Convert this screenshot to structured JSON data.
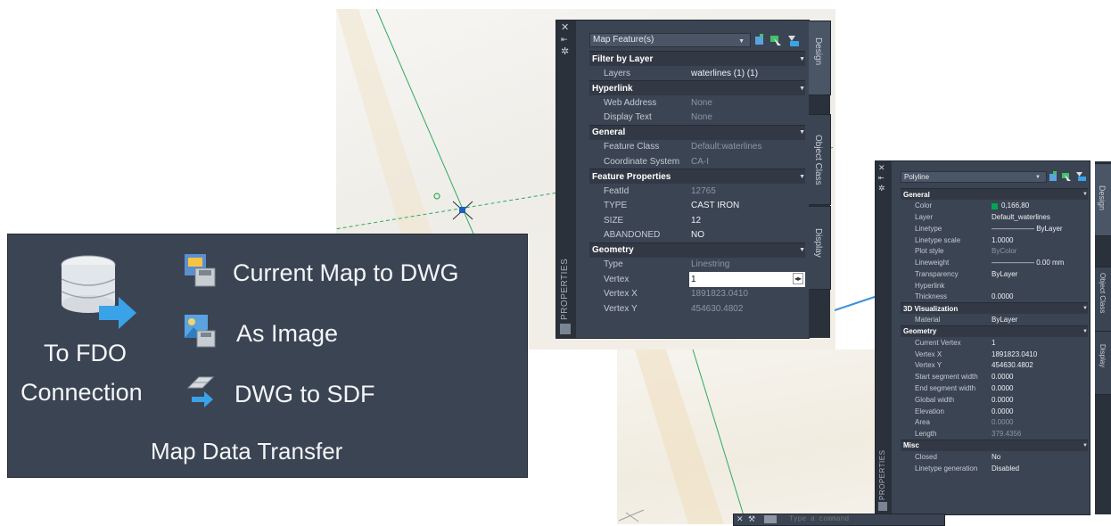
{
  "colors": {
    "panel_bg": "#3b4453",
    "panel_dark": "#2a313b",
    "text": "#eef1f4",
    "dim_text": "#8d96a1",
    "map_line_green": "#2eaa5f",
    "map_line_blue": "#3d8fd6",
    "layer_color_swatch": "#00a651"
  },
  "ribbon": {
    "to_fdo_line1": "To FDO",
    "to_fdo_line2": "Connection",
    "current_map_to_dwg": "Current Map to DWG",
    "as_image": "As Image",
    "dwg_to_sdf": "DWG to SDF",
    "panel_title": "Map Data Transfer"
  },
  "palette1": {
    "selector": "Map Feature(s)",
    "side_label": "PROPERTIES",
    "tabs": [
      "Design",
      "Object Class",
      "Display"
    ],
    "sections": [
      {
        "title": "Filter by Layer",
        "rows": [
          {
            "key": "Layers",
            "value": "waterlines (1) (1)",
            "dim": false
          }
        ]
      },
      {
        "title": "Hyperlink",
        "rows": [
          {
            "key": "Web Address",
            "value": "None",
            "dim": true
          },
          {
            "key": "Display Text",
            "value": "None",
            "dim": true
          }
        ]
      },
      {
        "title": "General",
        "rows": [
          {
            "key": "Feature Class",
            "value": "Default:waterlines",
            "dim": true
          },
          {
            "key": "Coordinate System",
            "value": "CA-I",
            "dim": true
          }
        ]
      },
      {
        "title": "Feature Properties",
        "rows": [
          {
            "key": "FeatId",
            "value": "12765",
            "dim": true
          },
          {
            "key": "TYPE",
            "value": "CAST IRON",
            "dim": false
          },
          {
            "key": "SIZE",
            "value": "12",
            "dim": false
          },
          {
            "key": "ABANDONED",
            "value": "NO",
            "dim": false
          }
        ]
      },
      {
        "title": "Geometry",
        "rows": [
          {
            "key": "Type",
            "value": "Linestring",
            "dim": true
          },
          {
            "key": "Vertex",
            "value": "1",
            "dim": false
          },
          {
            "key": "Vertex X",
            "value": "1891823.0410",
            "dim": true
          },
          {
            "key": "Vertex Y",
            "value": "454630.4802",
            "dim": true
          }
        ]
      }
    ]
  },
  "palette2": {
    "selector": "Polyline",
    "side_label": "PROPERTIES",
    "tabs": [
      "Design",
      "Object Class",
      "Display"
    ],
    "sections": [
      {
        "title": "General",
        "rows": [
          {
            "key": "Color",
            "value": "0,166,80",
            "dim": false
          },
          {
            "key": "Layer",
            "value": "Default_waterlines",
            "dim": false
          },
          {
            "key": "Linetype",
            "value": "——————  ByLayer",
            "dim": false
          },
          {
            "key": "Linetype scale",
            "value": "1.0000",
            "dim": false
          },
          {
            "key": "Plot style",
            "value": "ByColor",
            "dim": true
          },
          {
            "key": "Lineweight",
            "value": "——————  0.00 mm",
            "dim": false
          },
          {
            "key": "Transparency",
            "value": "ByLayer",
            "dim": false
          },
          {
            "key": "Hyperlink",
            "value": "",
            "dim": false
          },
          {
            "key": "Thickness",
            "value": "0.0000",
            "dim": false
          }
        ]
      },
      {
        "title": "3D Visualization",
        "rows": [
          {
            "key": "Material",
            "value": "ByLayer",
            "dim": false
          }
        ]
      },
      {
        "title": "Geometry",
        "rows": [
          {
            "key": "Current Vertex",
            "value": "1",
            "dim": false
          },
          {
            "key": "Vertex X",
            "value": "1891823.0410",
            "dim": false
          },
          {
            "key": "Vertex Y",
            "value": "454630.4802",
            "dim": false
          },
          {
            "key": "Start segment width",
            "value": "0.0000",
            "dim": false
          },
          {
            "key": "End segment width",
            "value": "0.0000",
            "dim": false
          },
          {
            "key": "Global width",
            "value": "0.0000",
            "dim": false
          },
          {
            "key": "Elevation",
            "value": "0.0000",
            "dim": false
          },
          {
            "key": "Area",
            "value": "0.0000",
            "dim": true
          },
          {
            "key": "Length",
            "value": "379.4356",
            "dim": true
          }
        ]
      },
      {
        "title": "Misc",
        "rows": [
          {
            "key": "Closed",
            "value": "No",
            "dim": false
          },
          {
            "key": "Linetype generation",
            "value": "Disabled",
            "dim": false
          }
        ]
      }
    ]
  },
  "command_line": {
    "placeholder": "Type a command"
  }
}
